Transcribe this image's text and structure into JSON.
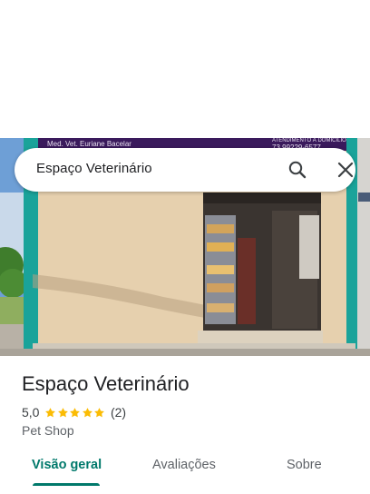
{
  "search": {
    "query": "Espaço Veterinário"
  },
  "photo": {
    "sign_left": "Med. Vet. Euriane Bacelar",
    "sign_right_line1": "ATENDIMENTO À DOMICÍLIO",
    "sign_right_line2": "73 99229-6577"
  },
  "place": {
    "title": "Espaço Veterinário",
    "rating": "5,0",
    "stars": 5,
    "review_count": "(2)",
    "category": "Pet Shop"
  },
  "tabs": [
    {
      "label": "Visão geral",
      "active": true
    },
    {
      "label": "Avaliações",
      "active": false
    },
    {
      "label": "Sobre",
      "active": false
    }
  ],
  "colors": {
    "accent": "#00796b",
    "star": "#fbbc04",
    "wall": "#e6d0ae",
    "frame": "#1aa39a",
    "sign": "#3a1a5c"
  },
  "icons": {
    "search": "search-icon",
    "close": "close-icon",
    "star": "star-icon"
  }
}
